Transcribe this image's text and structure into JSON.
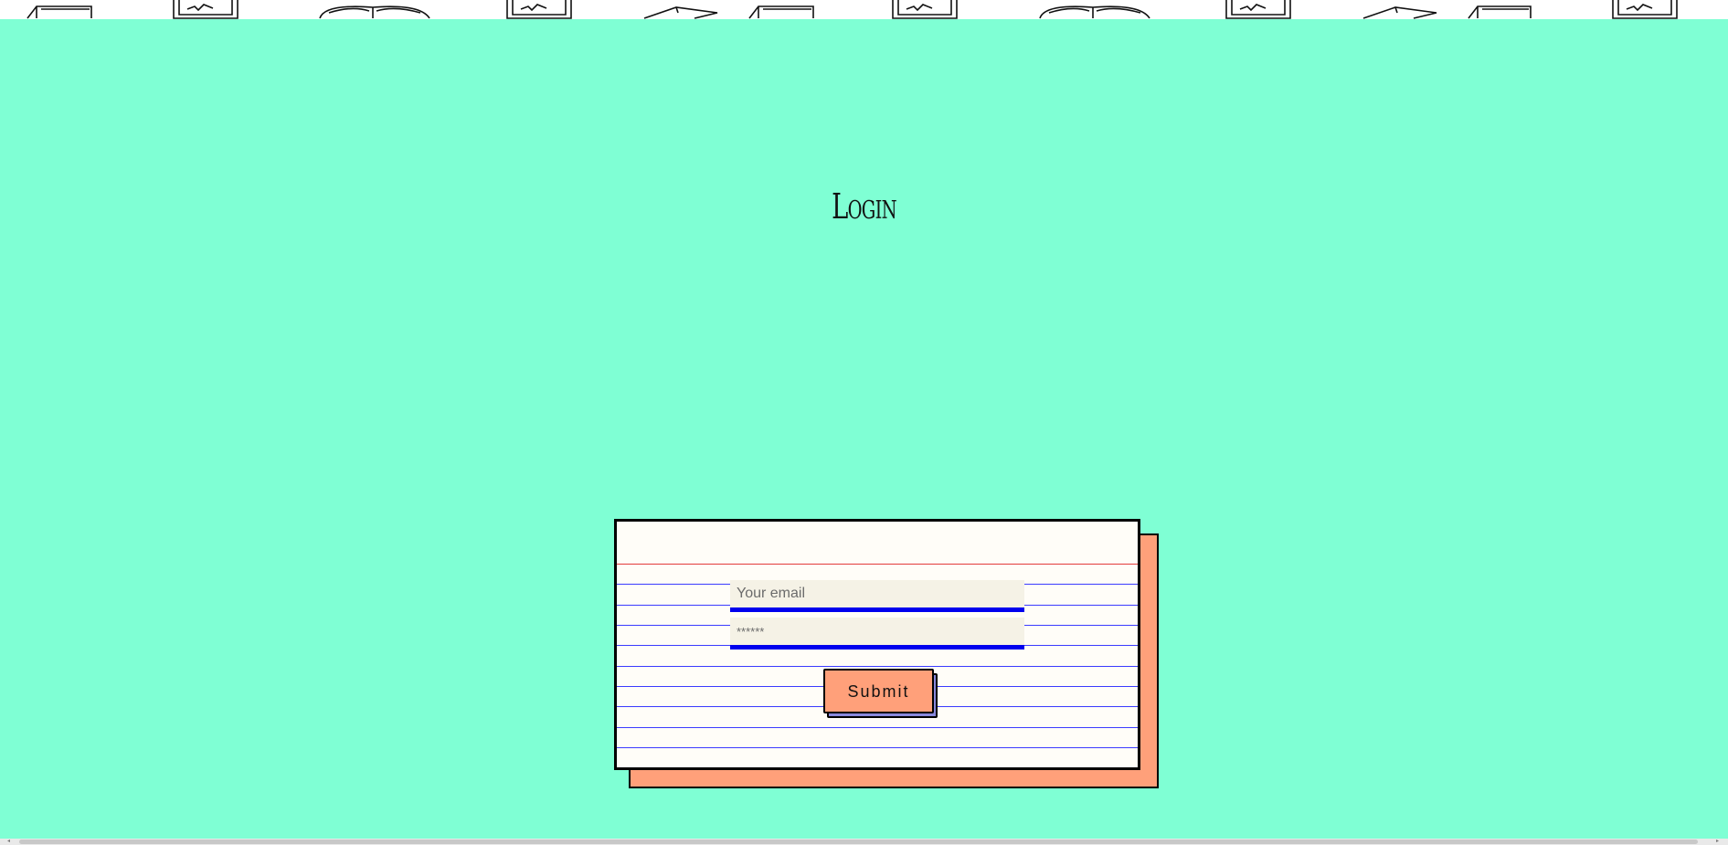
{
  "page": {
    "title": "Login"
  },
  "form": {
    "email_placeholder": "Your email",
    "password_placeholder": "******",
    "submit_label": "Submit"
  },
  "colors": {
    "background": "#7fffd4",
    "card": "#fffdf8",
    "card_shadow": "#ffa07a",
    "button": "#ffa07a",
    "button_shadow": "#8888dd",
    "field_underline": "#0000ee",
    "ruled_line": "#3b3bff",
    "margin_line": "#e23b3b"
  },
  "decor": {
    "header_pattern": "book-sketch-icon"
  }
}
